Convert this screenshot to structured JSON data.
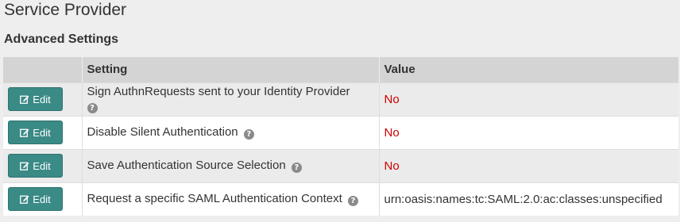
{
  "page": {
    "title": "Service Provider",
    "section_title": "Advanced Settings"
  },
  "table": {
    "headers": [
      "",
      "Setting",
      "Value"
    ],
    "rows": [
      {
        "edit_label": "Edit",
        "setting": "Sign AuthnRequests sent to your Identity Provider",
        "value": "No",
        "value_status": "negative"
      },
      {
        "edit_label": "Edit",
        "setting": "Disable Silent Authentication",
        "value": "No",
        "value_status": "negative"
      },
      {
        "edit_label": "Edit",
        "setting": "Save Authentication Source Selection",
        "value": "No",
        "value_status": "negative"
      },
      {
        "edit_label": "Edit",
        "setting": "Request a specific SAML Authentication Context",
        "value": "urn:oasis:names:tc:SAML:2.0:ac:classes:unspecified",
        "value_status": "neutral"
      }
    ]
  },
  "icons": {
    "edit": "edit-icon",
    "help": "question-circle-icon"
  },
  "help_glyph": "?",
  "colors": {
    "button_bg": "#3a8a86",
    "header_bg": "#d4d4d4",
    "negative_value": "#cc0000"
  }
}
